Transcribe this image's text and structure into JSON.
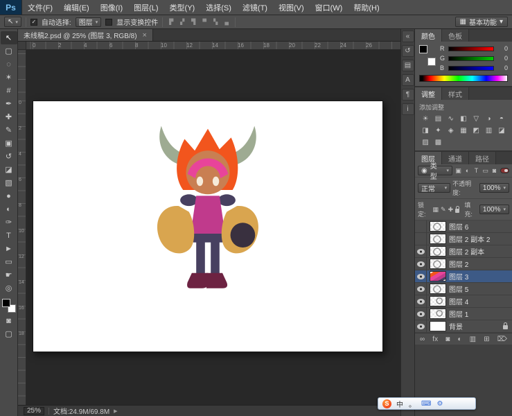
{
  "glyphs": {
    "dropdown": "▾",
    "panel_menu": "≡",
    "close": "×"
  },
  "colors": {
    "selected_layer": "#3d5a86",
    "canvas_bg": "#282828",
    "ps_logo_bg": "#0d2f4b"
  },
  "app": {
    "logo": "Ps",
    "menus": [
      {
        "label": "文件(F)"
      },
      {
        "label": "编辑(E)"
      },
      {
        "label": "图像(I)"
      },
      {
        "label": "图层(L)"
      },
      {
        "label": "类型(Y)"
      },
      {
        "label": "选择(S)"
      },
      {
        "label": "滤镜(T)"
      },
      {
        "label": "视图(V)"
      },
      {
        "label": "窗口(W)"
      },
      {
        "label": "帮助(H)"
      }
    ]
  },
  "options_bar": {
    "tool_glyph": "↖",
    "auto_select": {
      "label": "自动选择:",
      "checked": true,
      "check_glyph": "✓"
    },
    "target_dropdown": {
      "value": "图层"
    },
    "show_transform": {
      "label": "显示变换控件",
      "checked": false
    },
    "align_icons": [
      {
        "name": "align-left-edges-icon",
        "glyph": "▛"
      },
      {
        "name": "align-h-centers-icon",
        "glyph": "▞"
      },
      {
        "name": "align-right-edges-icon",
        "glyph": "▜"
      },
      {
        "name": "align-top-edges-icon",
        "glyph": "▀"
      },
      {
        "name": "align-v-centers-icon",
        "glyph": "▚"
      },
      {
        "name": "align-bottom-edges-icon",
        "glyph": "▄"
      }
    ],
    "workspace": {
      "label": "基本功能",
      "glyph": "▦"
    }
  },
  "document_tab": {
    "title": "未线稿2.psd @ 25% (图层 3, RGB/8)"
  },
  "tools": [
    {
      "name": "move-tool",
      "glyph": "↖",
      "active": true
    },
    {
      "name": "marquee-tool",
      "glyph": "▢"
    },
    {
      "name": "lasso-tool",
      "glyph": "◌"
    },
    {
      "name": "quick-selection-tool",
      "glyph": "✶"
    },
    {
      "name": "crop-tool",
      "glyph": "#"
    },
    {
      "name": "eyedropper-tool",
      "glyph": "✒"
    },
    {
      "name": "healing-brush-tool",
      "glyph": "✚"
    },
    {
      "name": "brush-tool",
      "glyph": "✎"
    },
    {
      "name": "clone-stamp-tool",
      "glyph": "▣"
    },
    {
      "name": "history-brush-tool",
      "glyph": "↺"
    },
    {
      "name": "eraser-tool",
      "glyph": "◪"
    },
    {
      "name": "gradient-tool",
      "glyph": "▧"
    },
    {
      "name": "blur-tool",
      "glyph": "●"
    },
    {
      "name": "dodge-tool",
      "glyph": "◐"
    },
    {
      "name": "pen-tool",
      "glyph": "✑"
    },
    {
      "name": "type-tool",
      "glyph": "T"
    },
    {
      "name": "path-selection-tool",
      "glyph": "►"
    },
    {
      "name": "shape-tool",
      "glyph": "▭"
    },
    {
      "name": "hand-tool",
      "glyph": "☛"
    },
    {
      "name": "zoom-tool",
      "glyph": "◎"
    }
  ],
  "toolbar_extra": [
    {
      "name": "quick-mask-icon",
      "glyph": "◙"
    },
    {
      "name": "screen-mode-icon",
      "glyph": "▢"
    }
  ],
  "rulers": {
    "top": [
      "0",
      "2",
      "4",
      "6",
      "8",
      "10",
      "12",
      "14",
      "16",
      "18",
      "20",
      "22",
      "24",
      "26"
    ],
    "left": [
      "0",
      "2",
      "4",
      "6",
      "8",
      "10",
      "12",
      "14",
      "16",
      "18"
    ]
  },
  "collapsed_panels": [
    {
      "name": "expand-panels-icon",
      "glyph": "«"
    },
    {
      "name": "history-panel-icon",
      "glyph": "↺"
    },
    {
      "name": "properties-panel-icon",
      "glyph": "▤"
    },
    {
      "name": "character-panel-icon",
      "glyph": "A"
    },
    {
      "name": "paragraph-panel-icon",
      "glyph": "¶"
    },
    {
      "name": "info-panel-icon",
      "glyph": "i"
    }
  ],
  "color_panel": {
    "tabs": [
      {
        "label": "颜色",
        "active": true
      },
      {
        "label": "色板",
        "active": false
      }
    ],
    "channels": [
      {
        "label": "R",
        "value": "0"
      },
      {
        "label": "G",
        "value": "0"
      },
      {
        "label": "B",
        "value": "0"
      }
    ]
  },
  "adjustments_panel": {
    "tabs": [
      {
        "label": "调整",
        "active": true
      },
      {
        "label": "样式",
        "active": false
      }
    ],
    "add_label": "添加调整",
    "icons": [
      {
        "name": "brightness-contrast-icon",
        "glyph": "☀"
      },
      {
        "name": "levels-icon",
        "glyph": "▤"
      },
      {
        "name": "curves-icon",
        "glyph": "∿"
      },
      {
        "name": "exposure-icon",
        "glyph": "◧"
      },
      {
        "name": "vibrance-icon",
        "glyph": "▽"
      },
      {
        "name": "hue-saturation-icon",
        "glyph": "◑"
      },
      {
        "name": "color-balance-icon",
        "glyph": "◓"
      },
      {
        "name": "black-white-icon",
        "glyph": "◨"
      },
      {
        "name": "photo-filter-icon",
        "glyph": "✦"
      },
      {
        "name": "channel-mixer-icon",
        "glyph": "◈"
      },
      {
        "name": "color-lookup-icon",
        "glyph": "▦"
      },
      {
        "name": "invert-icon",
        "glyph": "◩"
      },
      {
        "name": "posterize-icon",
        "glyph": "▥"
      },
      {
        "name": "threshold-icon",
        "glyph": "◪"
      },
      {
        "name": "selective-color-icon",
        "glyph": "▨"
      },
      {
        "name": "gradient-map-icon",
        "glyph": "▩"
      }
    ]
  },
  "layers_panel": {
    "tabs": [
      {
        "label": "图层",
        "active": true
      },
      {
        "label": "通道",
        "active": false
      },
      {
        "label": "路径",
        "active": false
      }
    ],
    "filter": {
      "kind_glyph": "◉",
      "label": "类型",
      "icons": [
        {
          "name": "filter-pixel-layers-icon",
          "glyph": "▣"
        },
        {
          "name": "filter-adjustment-layers-icon",
          "glyph": "◐"
        },
        {
          "name": "filter-type-layers-icon",
          "glyph": "T"
        },
        {
          "name": "filter-shape-layers-icon",
          "glyph": "▭"
        },
        {
          "name": "filter-smart-objects-icon",
          "glyph": "◙"
        }
      ]
    },
    "blend_mode": "正常",
    "opacity_label": "不透明度:",
    "opacity_value": "100%",
    "lock_label": "锁定:",
    "lock_icons": [
      {
        "name": "lock-transparency-icon",
        "glyph": "▦"
      },
      {
        "name": "lock-pixels-icon",
        "glyph": "✎"
      },
      {
        "name": "lock-position-icon",
        "glyph": "✚"
      }
    ],
    "fill_label": "填充:",
    "fill_value": "100%",
    "layers": [
      {
        "name": "图层 6",
        "visible": false,
        "selected": false,
        "thumb": "sketch",
        "locked": false
      },
      {
        "name": "图层 2 副本 2",
        "visible": false,
        "selected": false,
        "thumb": "sketch",
        "locked": false
      },
      {
        "name": "图层 2 副本",
        "visible": true,
        "selected": false,
        "thumb": "sketch",
        "locked": false
      },
      {
        "name": "图层 2",
        "visible": true,
        "selected": false,
        "thumb": "sketch",
        "locked": false
      },
      {
        "name": "图层 3",
        "visible": true,
        "selected": true,
        "thumb": "colored",
        "locked": false
      },
      {
        "name": "图层 5",
        "visible": true,
        "selected": false,
        "thumb": "sketch",
        "locked": false
      },
      {
        "name": "图层 4",
        "visible": true,
        "selected": false,
        "thumb": "sketch2",
        "locked": false
      },
      {
        "name": "图层 1",
        "visible": true,
        "selected": false,
        "thumb": "sketch2",
        "locked": false
      },
      {
        "name": "背景",
        "visible": true,
        "selected": false,
        "thumb": "white",
        "locked": true
      }
    ],
    "footer_icons": [
      {
        "name": "link-layers-icon",
        "glyph": "∞"
      },
      {
        "name": "layer-style-icon",
        "glyph": "fx"
      },
      {
        "name": "add-layer-mask-icon",
        "glyph": "◙"
      },
      {
        "name": "new-adjustment-layer-icon",
        "glyph": "◐"
      },
      {
        "name": "new-group-icon",
        "glyph": "▥"
      },
      {
        "name": "new-layer-icon",
        "glyph": "⊞"
      },
      {
        "name": "delete-layer-icon",
        "glyph": "⌦"
      }
    ]
  },
  "status_bar": {
    "zoom": "25%",
    "doc_info": "文档:24.9M/69.8M",
    "expand_glyph": "▶"
  },
  "ime_bar": {
    "logo": "S",
    "items": [
      {
        "name": "ime-lang-icon",
        "glyph": "中",
        "cls": ""
      },
      {
        "name": "ime-punctuation-icon",
        "glyph": "。",
        "cls": ""
      },
      {
        "name": "ime-keyboard-icon",
        "glyph": "⌨",
        "cls": "blue"
      },
      {
        "name": "ime-toolbox-icon",
        "glyph": "⚙",
        "cls": "blue"
      }
    ]
  }
}
